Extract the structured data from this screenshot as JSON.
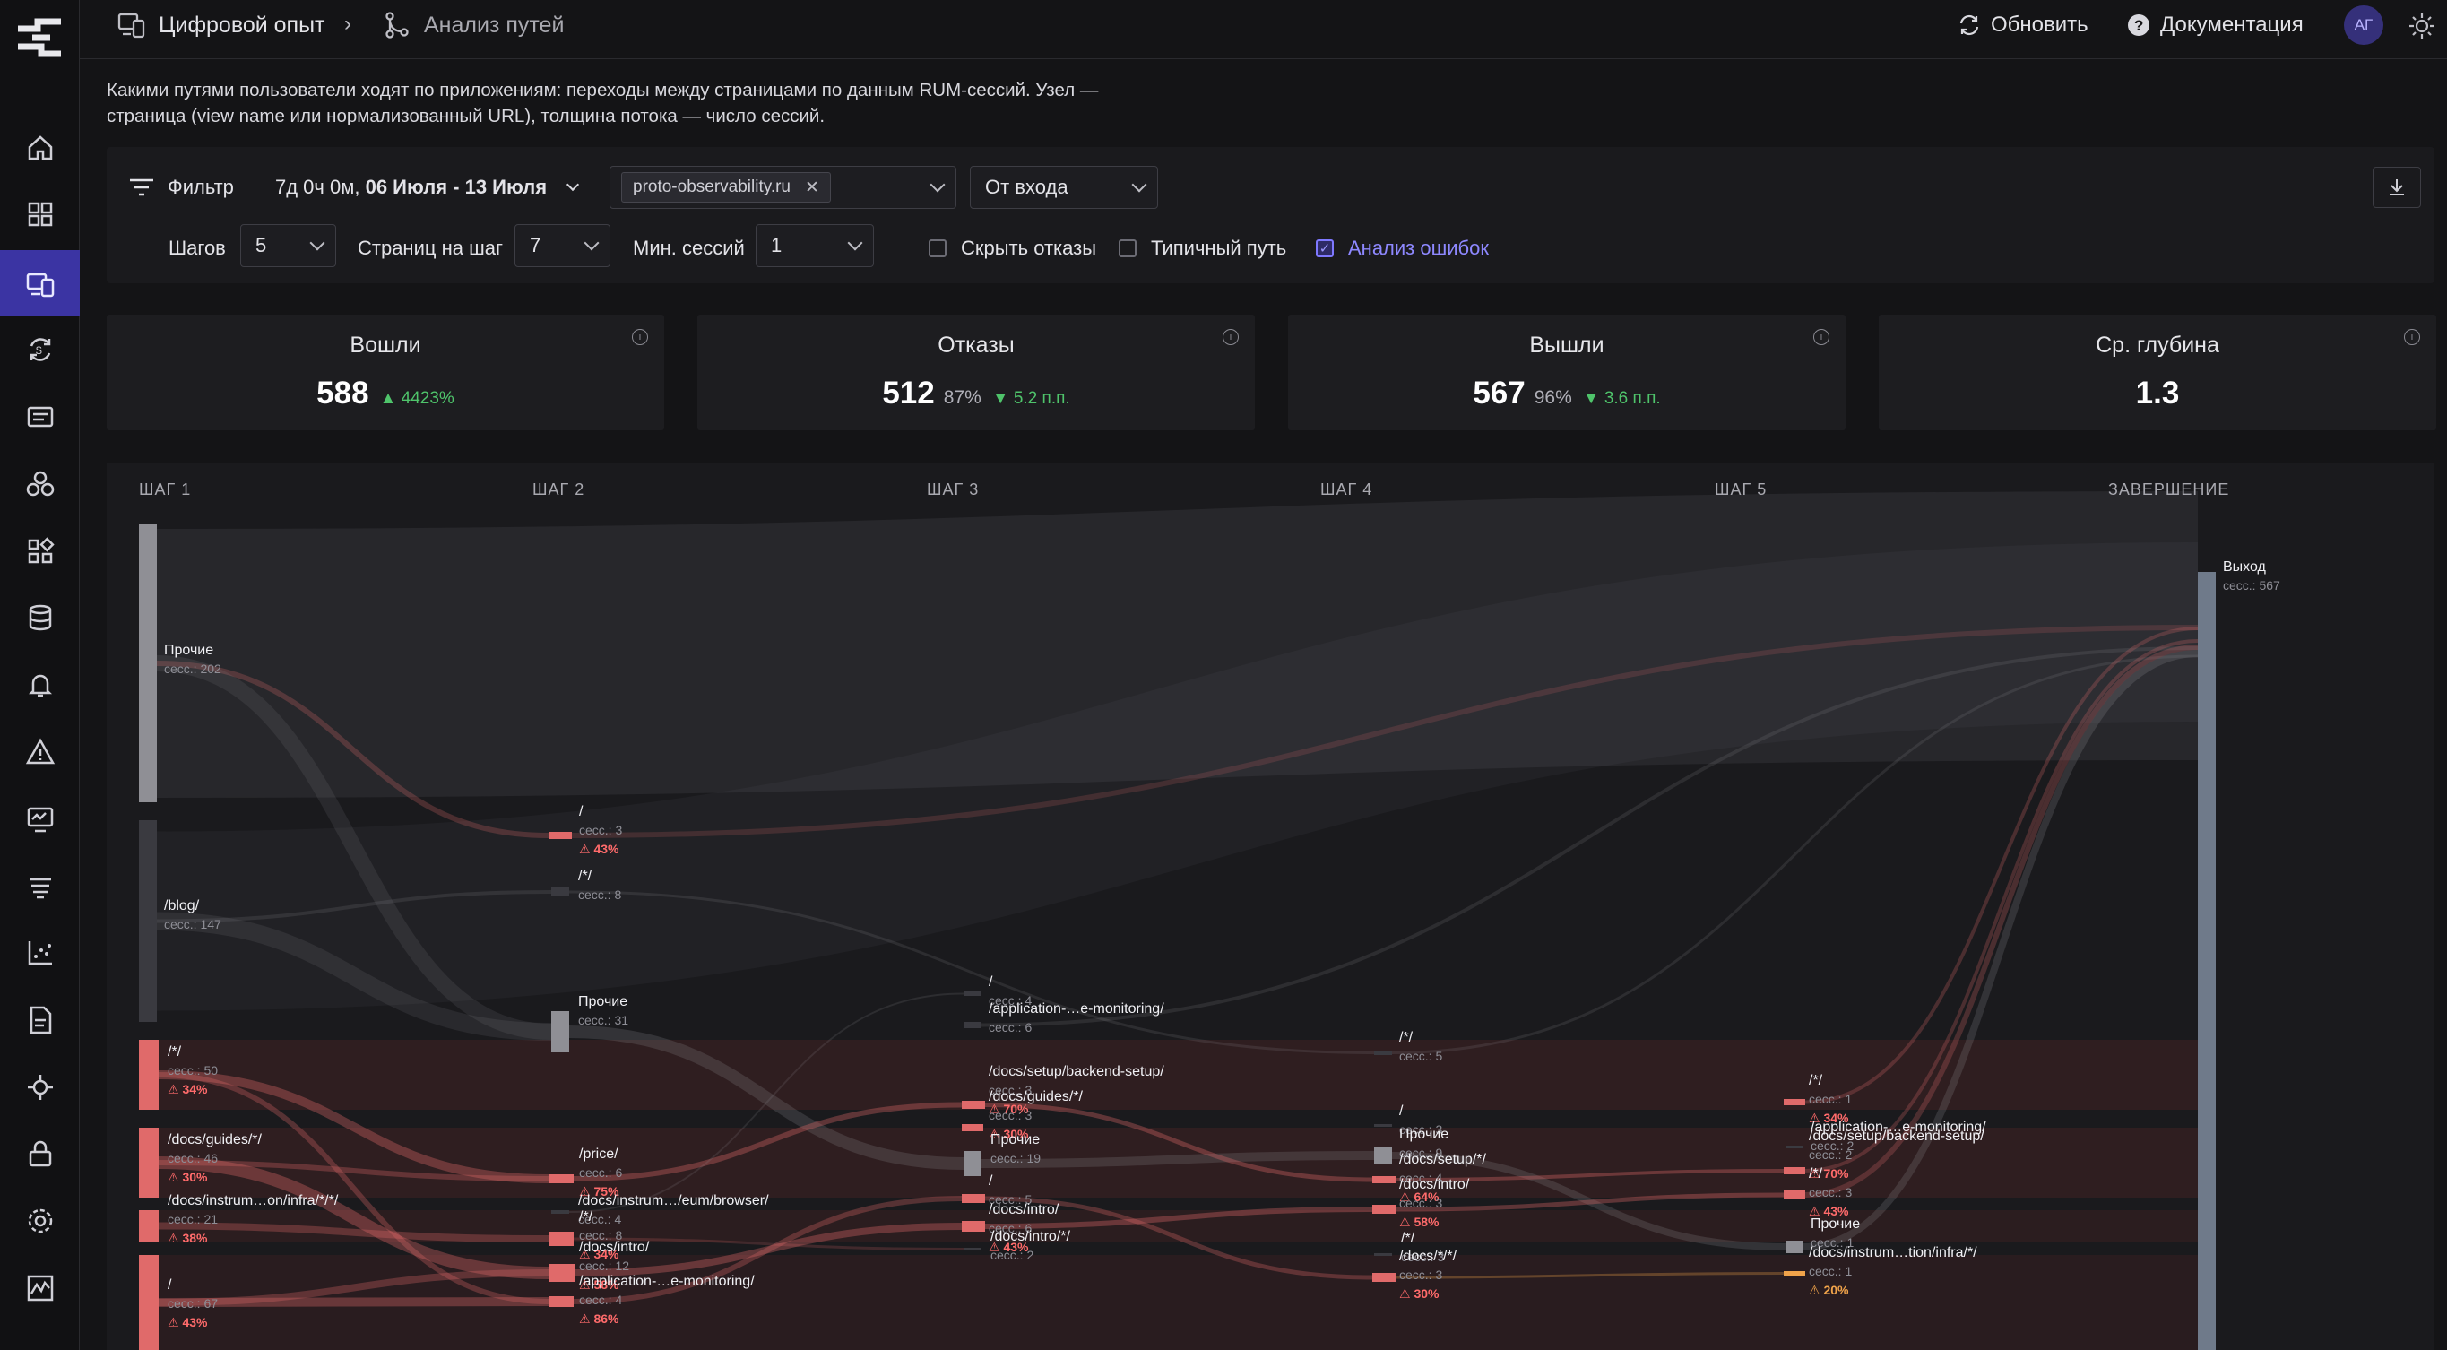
{
  "header": {
    "crumb1": "Цифровой опыт",
    "crumb_sep": "›",
    "crumb2": "Анализ путей",
    "refresh": "Обновить",
    "docs": "Документация",
    "avatar": "АГ"
  },
  "description": "Какими путями пользователи ходят по приложениям: переходы между страницами по данным RUM-сессий. Узел — страница (view name или нормализованный URL), толщина потока — число сессий.",
  "filters": {
    "filter_label": "Фильтр",
    "period_prefix": "7д 0ч 0м, ",
    "period_range": "06 Июля - 13 Июля",
    "app_tag": "proto-observability.ru",
    "mode": "От входа",
    "steps_label": "Шагов",
    "steps_value": "5",
    "pages_label": "Страниц на шаг",
    "pages_value": "7",
    "min_label": "Мин. сессий",
    "min_value": "1",
    "hide_bounces": "Скрыть отказы",
    "typical_path": "Типичный путь",
    "error_analysis": "Анализ ошибок"
  },
  "metrics": [
    {
      "label": "Вошли",
      "value": "588",
      "pct": "",
      "delta": "▲ 4423%"
    },
    {
      "label": "Отказы",
      "value": "512",
      "pct": "87%",
      "delta": "▼ 5.2 п.п."
    },
    {
      "label": "Вышли",
      "value": "567",
      "pct": "96%",
      "delta": "▼ 3.6 п.п."
    },
    {
      "label": "Ср. глубина",
      "value": "1.3",
      "pct": "",
      "delta": ""
    }
  ],
  "steps": [
    "ШАГ 1",
    "ШАГ 2",
    "ШАГ 3",
    "ШАГ 4",
    "ШАГ 5",
    "ЗАВЕРШЕНИЕ"
  ],
  "colors": {
    "accent": "#3b34a3",
    "error": "#e06a6a",
    "warn": "#f0a34a",
    "ok": "#4fc46b",
    "exit": "#6f7a8a"
  },
  "nodes": [
    {
      "step": 1,
      "label": "Прочие",
      "sessions": "сесс.: 202",
      "err": ""
    },
    {
      "step": 1,
      "label": "/blog/",
      "sessions": "сесс.: 147",
      "err": ""
    },
    {
      "step": 1,
      "label": "/*/",
      "sessions": "сесс.: 50",
      "err": "⚠ 34%"
    },
    {
      "step": 1,
      "label": "/docs/guides/*/",
      "sessions": "сесс.: 46",
      "err": "⚠ 30%"
    },
    {
      "step": 1,
      "label": "/docs/instrum…on/infra/*/*/",
      "sessions": "сесс.: 21",
      "err": "⚠ 38%"
    },
    {
      "step": 1,
      "label": "/",
      "sessions": "сесс.: 67",
      "err": "⚠ 43%"
    },
    {
      "step": 2,
      "label": "/",
      "sessions": "сесс.: 3",
      "err": "⚠ 43%"
    },
    {
      "step": 2,
      "label": "/*/",
      "sessions": "сесс.: 8",
      "err": ""
    },
    {
      "step": 2,
      "label": "Прочие",
      "sessions": "сесс.: 31",
      "err": ""
    },
    {
      "step": 2,
      "label": "/price/",
      "sessions": "сесс.: 6",
      "err": "⚠ 75%"
    },
    {
      "step": 2,
      "label": "/docs/instrum…/eum/browser/",
      "sessions": "сесс.: 4",
      "err": ""
    },
    {
      "step": 2,
      "label": "/*/",
      "sessions": "сесс.: 8",
      "err": "⚠ 34%"
    },
    {
      "step": 2,
      "label": "/docs/intro/",
      "sessions": "сесс.: 12",
      "err": "⚠ 58%"
    },
    {
      "step": 2,
      "label": "/application-…e-monitoring/",
      "sessions": "сесс.: 4",
      "err": "⚠ 86%"
    },
    {
      "step": 3,
      "label": "/",
      "sessions": "сесс.: 4",
      "err": ""
    },
    {
      "step": 3,
      "label": "/application-…e-monitoring/",
      "sessions": "сесс.: 6",
      "err": ""
    },
    {
      "step": 3,
      "label": "/docs/setup/backend-setup/",
      "sessions": "сесс.: 3",
      "err": "⚠ 70%"
    },
    {
      "step": 3,
      "label": "/docs/guides/*/",
      "sessions": "сесс.: 3",
      "err": "⚠ 30%"
    },
    {
      "step": 3,
      "label": "Прочие",
      "sessions": "сесс.: 19",
      "err": ""
    },
    {
      "step": 3,
      "label": "/",
      "sessions": "сесс.: 5",
      "err": ""
    },
    {
      "step": 3,
      "label": "/docs/intro/",
      "sessions": "сесс.: 6",
      "err": "⚠ 43%"
    },
    {
      "step": 3,
      "label": "/docs/intro/*/",
      "sessions": "сесс.: 2",
      "err": ""
    },
    {
      "step": 4,
      "label": "/*/",
      "sessions": "сесс.: 5",
      "err": ""
    },
    {
      "step": 4,
      "label": "/",
      "sessions": "сесс.: 3",
      "err": ""
    },
    {
      "step": 4,
      "label": "Прочие",
      "sessions": "сесс.: 9",
      "err": ""
    },
    {
      "step": 4,
      "label": "/docs/setup/*/",
      "sessions": "сесс.: 4",
      "err": "⚠ 64%"
    },
    {
      "step": 4,
      "label": "/docs/intro/",
      "sessions": "сесс.: 3",
      "err": "⚠ 58%"
    },
    {
      "step": 4,
      "label": "/*/",
      "sessions": "сесс.: 3",
      "err": ""
    },
    {
      "step": 4,
      "label": "/docs/*/*/",
      "sessions": "сесс.: 3",
      "err": "⚠ 30%"
    },
    {
      "step": 5,
      "label": "/*/",
      "sessions": "сесс.: 1",
      "err": "⚠ 34%"
    },
    {
      "step": 5,
      "label": "/application-…e-monitoring/",
      "sessions": "сесс.: 2",
      "err": ""
    },
    {
      "step": 5,
      "label": "/docs/setup/backend-setup/",
      "sessions": "сесс.: 2",
      "err": "⚠ 70%"
    },
    {
      "step": 5,
      "label": "/*/",
      "sessions": "сесс.: 3",
      "err": "⚠ 43%"
    },
    {
      "step": 5,
      "label": "Прочие",
      "sessions": "сесс.: 1",
      "err": ""
    },
    {
      "step": 5,
      "label": "/docs/instrum…tion/infra/*/",
      "sessions": "сесс.: 1",
      "err": "⚠ 20%"
    },
    {
      "step": 6,
      "label": "Выход",
      "sessions": "сесс.: 567",
      "err": ""
    }
  ]
}
